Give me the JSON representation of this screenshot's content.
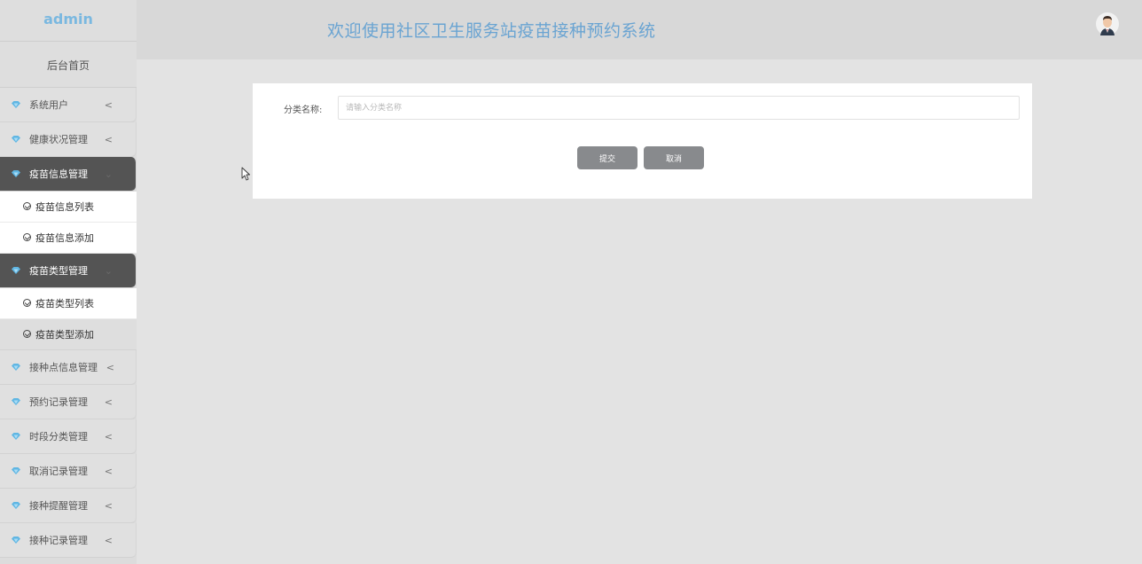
{
  "sidebar": {
    "brand": "admin",
    "home": "后台首页",
    "menus": [
      {
        "label": "系统用户",
        "open": false
      },
      {
        "label": "健康状况管理",
        "open": false
      },
      {
        "label": "疫苗信息管理",
        "open": true,
        "children": [
          "疫苗信息列表",
          "疫苗信息添加"
        ]
      },
      {
        "label": "疫苗类型管理",
        "open": true,
        "children": [
          "疫苗类型列表",
          "疫苗类型添加"
        ]
      },
      {
        "label": "接种点信息管理",
        "open": false
      },
      {
        "label": "预约记录管理",
        "open": false
      },
      {
        "label": "时段分类管理",
        "open": false
      },
      {
        "label": "取消记录管理",
        "open": false
      },
      {
        "label": "接种提醒管理",
        "open": false
      },
      {
        "label": "接种记录管理",
        "open": false
      }
    ],
    "chevron": "<",
    "icon": "diamond-icon"
  },
  "header": {
    "title": "欢迎使用社区卫生服务站疫苗接种预约系统",
    "avatar_icon": "user-avatar"
  },
  "form": {
    "field_label": "分类名称:",
    "field_placeholder": "请输入分类名称",
    "field_value": "",
    "submit_label": "提交",
    "cancel_label": "取消"
  },
  "colors": {
    "accent": "#6aa4d2",
    "active_menu": "#545454",
    "button": "#888a8d",
    "gem": "#5fb6e3"
  }
}
